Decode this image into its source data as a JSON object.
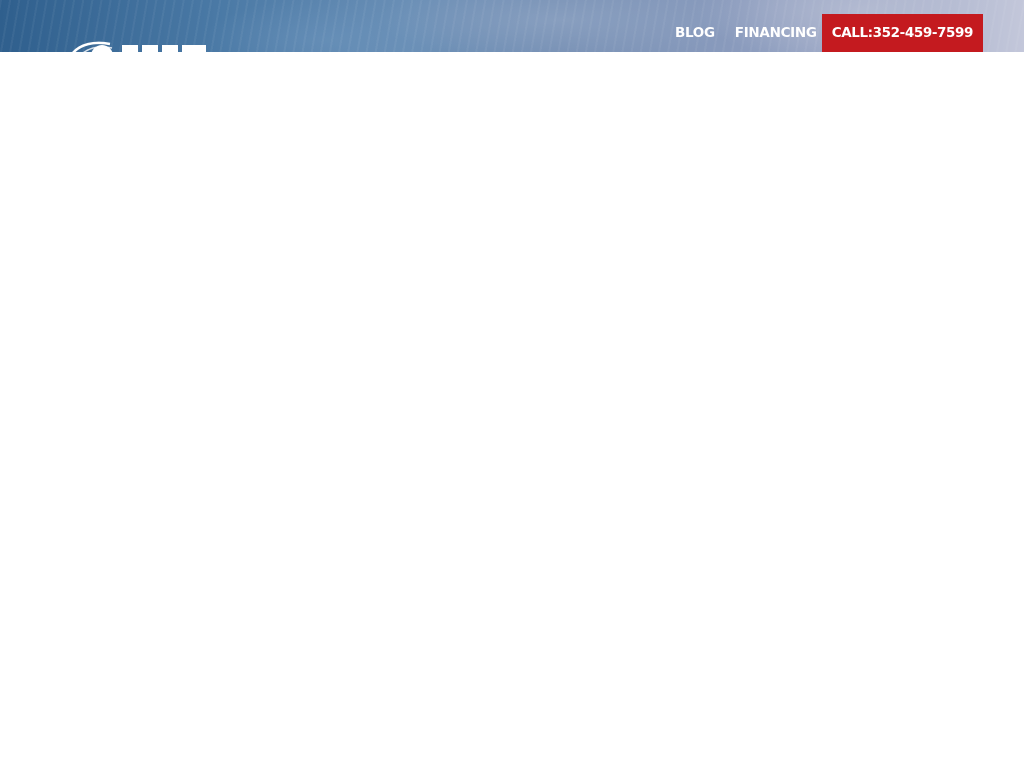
{
  "header": {
    "logo_icon": "company-logo",
    "nav": [
      {
        "label": "BLOG"
      },
      {
        "label": "FINANCING"
      }
    ],
    "call": {
      "prefix": "CALL:",
      "phone": "352-459-7599"
    }
  },
  "colors": {
    "call_button": "#c41a1f",
    "nav_text": "#ffffff",
    "header_blue": "#4b7aa6",
    "page_background": "#ffffff"
  }
}
